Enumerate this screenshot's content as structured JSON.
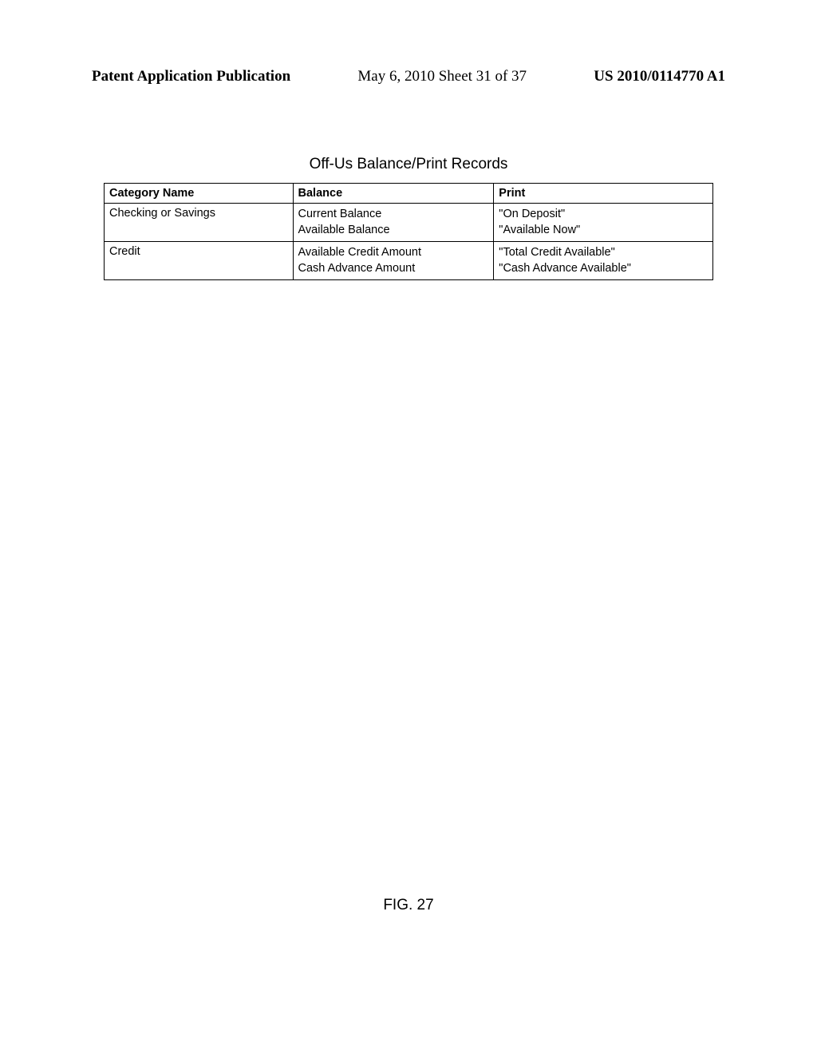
{
  "header": {
    "left": "Patent Application Publication",
    "center": "May 6, 2010  Sheet 31 of 37",
    "right": "US 2010/0114770 A1"
  },
  "table": {
    "title": "Off-Us Balance/Print Records",
    "headers": {
      "category": "Category Name",
      "balance": "Balance",
      "print": "Print"
    },
    "rows": [
      {
        "category": "Checking or Savings",
        "balance_line1": "Current Balance",
        "balance_line2": "Available Balance",
        "print_line1": "\"On Deposit\"",
        "print_line2": "\"Available Now\""
      },
      {
        "category": "Credit",
        "balance_line1": "Available Credit Amount",
        "balance_line2": "Cash Advance Amount",
        "print_line1": "\"Total Credit Available\"",
        "print_line2": "\"Cash Advance Available\""
      }
    ]
  },
  "figure_label": "FIG. 27"
}
